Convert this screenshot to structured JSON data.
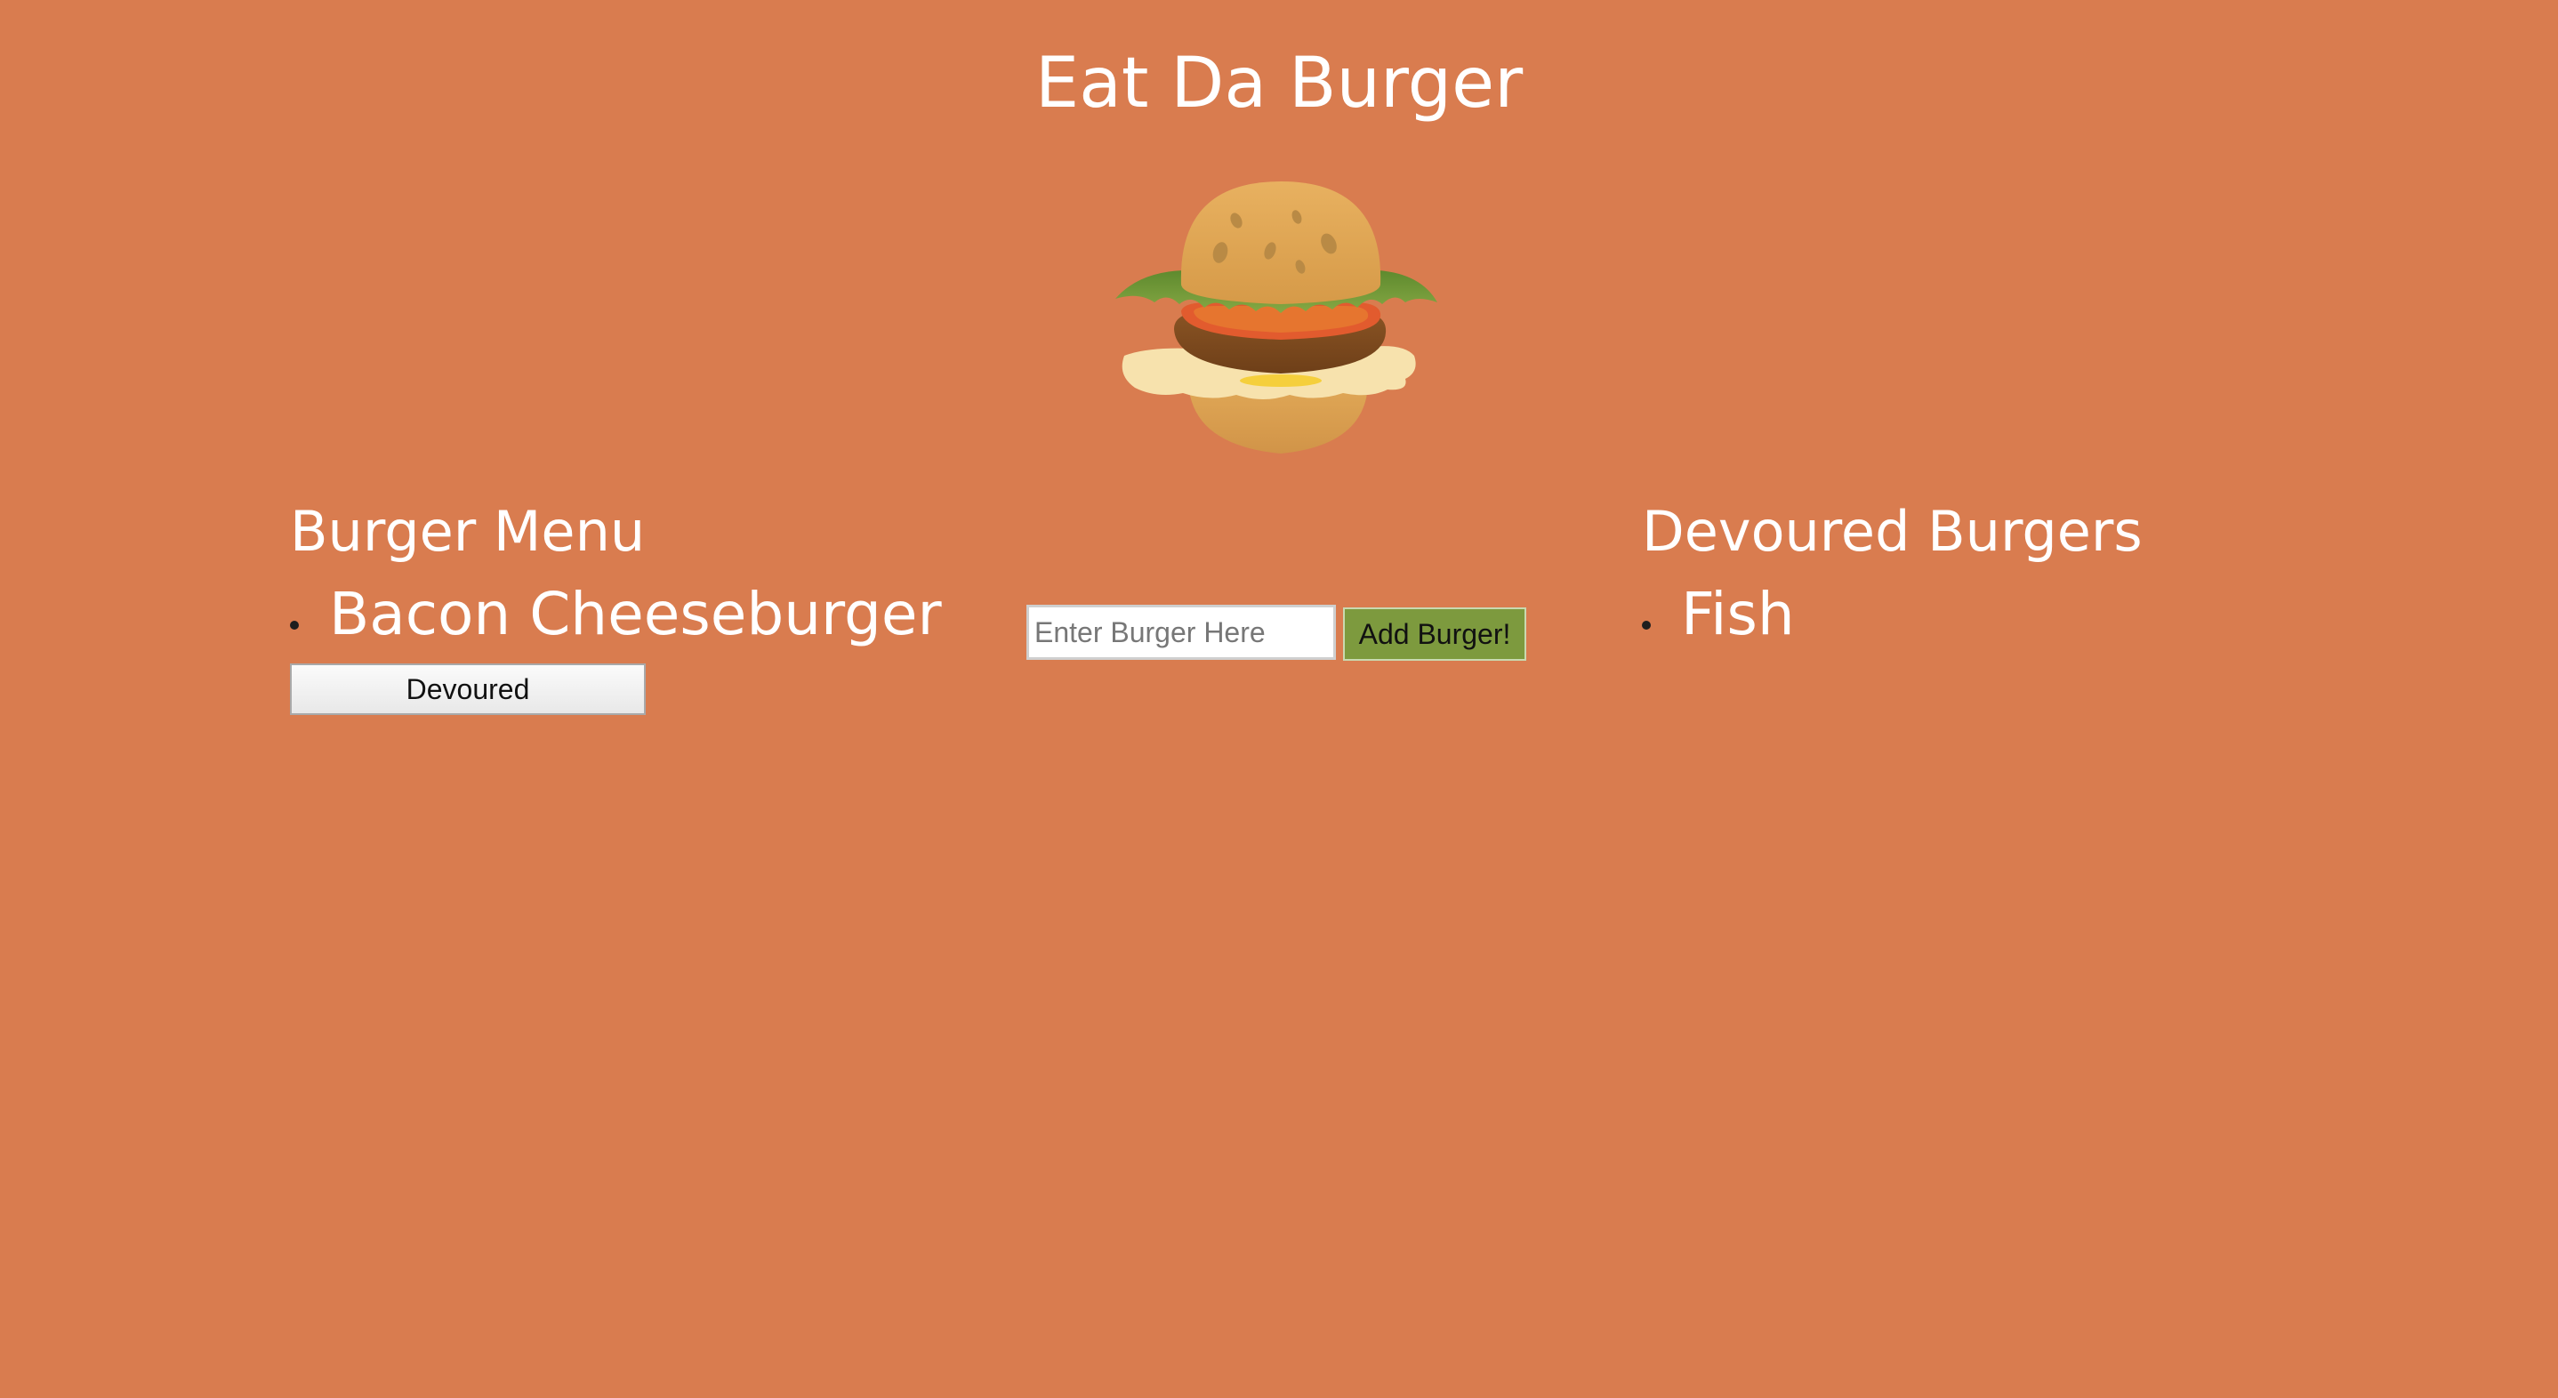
{
  "header": {
    "title": "Eat Da Burger"
  },
  "hero": {
    "icon": "burger-icon"
  },
  "menu": {
    "heading": "Burger Menu",
    "items": [
      {
        "name": "Bacon Cheeseburger",
        "button_label": "Devoured"
      }
    ]
  },
  "add_form": {
    "placeholder": "Enter Burger Here",
    "value": "",
    "button_label": "Add Burger!"
  },
  "devoured": {
    "heading": "Devoured Burgers",
    "items": [
      {
        "name": "Fish"
      }
    ]
  },
  "colors": {
    "background": "#d97c4f",
    "text": "#ffffff",
    "add_button": "#7d9a3e"
  }
}
